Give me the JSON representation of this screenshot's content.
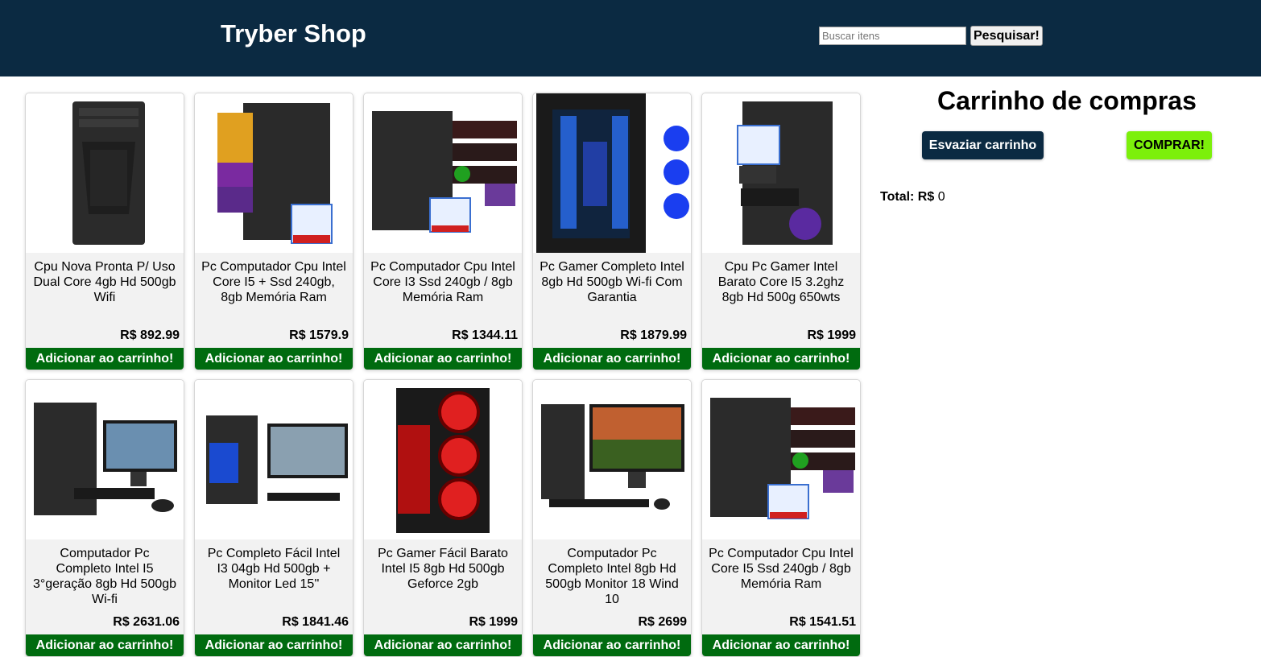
{
  "header": {
    "logo": "Tryber Shop",
    "search_placeholder": "Buscar itens",
    "search_button": "Pesquisar!"
  },
  "cart": {
    "title": "Carrinho de compras",
    "empty_button": "Esvaziar carrinho",
    "buy_button": "COMPRAR!",
    "total_label": "Total: R$",
    "total_value": "0"
  },
  "products": [
    {
      "title": "Cpu Nova Pronta P/ Uso Dual Core 4gb Hd 500gb Wifi",
      "price": "R$ 892.99",
      "button": "Adicionar ao carrinho!",
      "image": "tower-plain"
    },
    {
      "title": "Pc Computador Cpu Intel Core I5 + Ssd 240gb, 8gb Memória Ram",
      "price": "R$ 1579.9",
      "button": "Adicionar ao carrinho!",
      "image": "tower-with-spec-label"
    },
    {
      "title": "Pc Computador Cpu Intel Core I3 Ssd 240gb / 8gb Memória Ram",
      "price": "R$ 1344.11",
      "button": "Adicionar ao carrinho!",
      "image": "tower-with-badges"
    },
    {
      "title": "Pc Gamer Completo Intel 8gb Hd 500gb Wi-fi Com Garantia",
      "price": "R$ 1879.99",
      "button": "Adicionar ao carrinho!",
      "image": "gamer-tower-blue"
    },
    {
      "title": "Cpu Pc Gamer Intel Barato Core I5 3.2ghz 8gb Hd 500g 650wts",
      "price": "R$ 1999",
      "button": "Adicionar ao carrinho!",
      "image": "gamer-tower-stickers"
    },
    {
      "title": "Computador Pc Completo Intel I5 3°geração 8gb Hd 500gb Wi-fi",
      "price": "R$ 2631.06",
      "button": "Adicionar ao carrinho!",
      "image": "desktop-set-city"
    },
    {
      "title": "Pc Completo Fácil Intel I3 04gb Hd 500gb + Monitor Led 15''",
      "price": "R$ 1841.46",
      "button": "Adicionar ao carrinho!",
      "image": "desktop-set-monitor"
    },
    {
      "title": "Pc Gamer Fácil Barato Intel I5 8gb Hd 500gb Geforce 2gb",
      "price": "R$ 1999",
      "button": "Adicionar ao carrinho!",
      "image": "gamer-tower-red"
    },
    {
      "title": "Computador Pc Completo Intel 8gb Hd 500gb Monitor 18 Wind 10",
      "price": "R$ 2699",
      "button": "Adicionar ao carrinho!",
      "image": "desktop-set-sunset"
    },
    {
      "title": "Pc Computador Cpu Intel Core I5 Ssd 240gb / 8gb Memória Ram",
      "price": "R$ 1541.51",
      "button": "Adicionar ao carrinho!",
      "image": "tower-with-badges"
    }
  ]
}
